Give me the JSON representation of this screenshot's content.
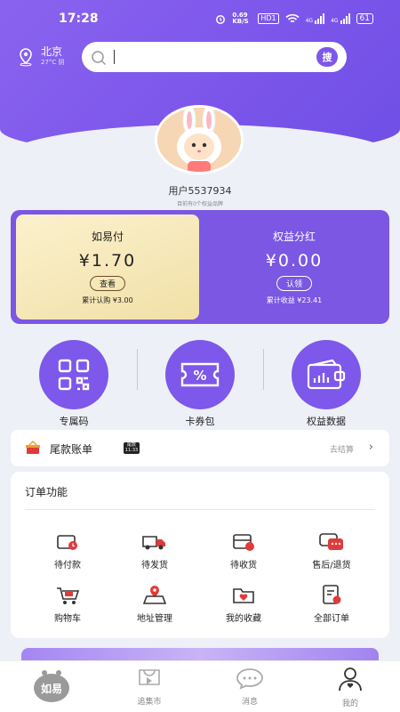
{
  "status_bar": {
    "time": "17:28",
    "speed": "0.69 KB/S",
    "hd": "HD1",
    "net1": "4G",
    "net2": "4G",
    "battery": "61"
  },
  "location": {
    "city": "北京",
    "weather": "27°C 阴"
  },
  "search": {
    "placeholder": "",
    "button_label": "搜"
  },
  "user": {
    "name": "用户5537934",
    "subtitle": "目前有0个权益品牌"
  },
  "wallet": {
    "left": {
      "title": "如易付",
      "amount": "¥1.70",
      "button": "查看",
      "note": "累计认购 ¥3.00"
    },
    "right": {
      "title": "权益分红",
      "amount": "¥0.00",
      "button": "认领",
      "note": "累计收益 ¥23.41"
    }
  },
  "features": [
    {
      "label": "专属码",
      "icon": "qr-code-icon"
    },
    {
      "label": "卡券包",
      "icon": "coupon-icon"
    },
    {
      "label": "权益数据",
      "icon": "wallet-chart-icon"
    }
  ],
  "bill": {
    "label": "尾款账单",
    "tag": "尾款 11:33",
    "action": "去结算"
  },
  "orders": {
    "title": "订单功能",
    "items": [
      {
        "label": "待付款",
        "icon": "wallet-pending-icon"
      },
      {
        "label": "待发货",
        "icon": "truck-icon"
      },
      {
        "label": "待收货",
        "icon": "package-icon"
      },
      {
        "label": "售后/退货",
        "icon": "chat-service-icon"
      },
      {
        "label": "购物车",
        "icon": "cart-icon"
      },
      {
        "label": "地址管理",
        "icon": "address-icon"
      },
      {
        "label": "我的收藏",
        "icon": "favorite-folder-icon"
      },
      {
        "label": "全部订单",
        "icon": "all-orders-icon"
      }
    ]
  },
  "tabs": [
    {
      "label": "如易",
      "icon": "home-logo-icon"
    },
    {
      "label": "追集市",
      "icon": "market-icon"
    },
    {
      "label": "消息",
      "icon": "message-icon"
    },
    {
      "label": "我的",
      "icon": "profile-icon"
    }
  ],
  "colors": {
    "primary": "#7b57e4",
    "accent_red": "#e03a3a",
    "gold": "#f3e2ab"
  }
}
